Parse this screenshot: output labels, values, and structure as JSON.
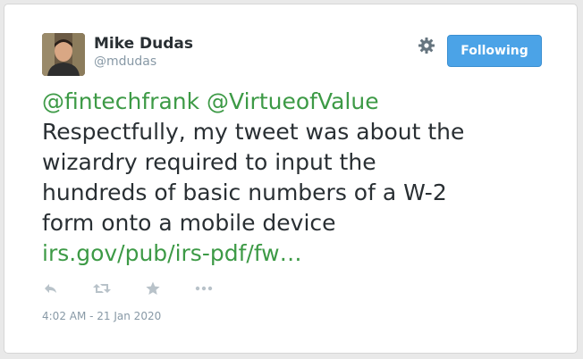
{
  "tweet": {
    "author": {
      "name": "Mike Dudas",
      "handle": "@mdudas",
      "avatar_icon": "user-photo"
    },
    "follow_button_label": "Following",
    "settings_icon": "gear-icon",
    "mentions": [
      "@fintechfrank",
      "@VirtueofValue"
    ],
    "text_lines": [
      "Respectfully, my tweet was about the",
      "wizardry required to input the",
      "hundreds of basic numbers of a W-2",
      "form onto a mobile device"
    ],
    "link_text": "irs.gov/pub/irs-pdf/fw…",
    "actions": [
      "reply-icon",
      "retweet-icon",
      "favorite-icon",
      "more-icon"
    ],
    "timestamp": "4:02 AM - 21 Jan 2020"
  },
  "colors": {
    "link": "#3d9a46",
    "text": "#292f33",
    "muted": "#8899a6",
    "button": "#4ba3e7"
  }
}
